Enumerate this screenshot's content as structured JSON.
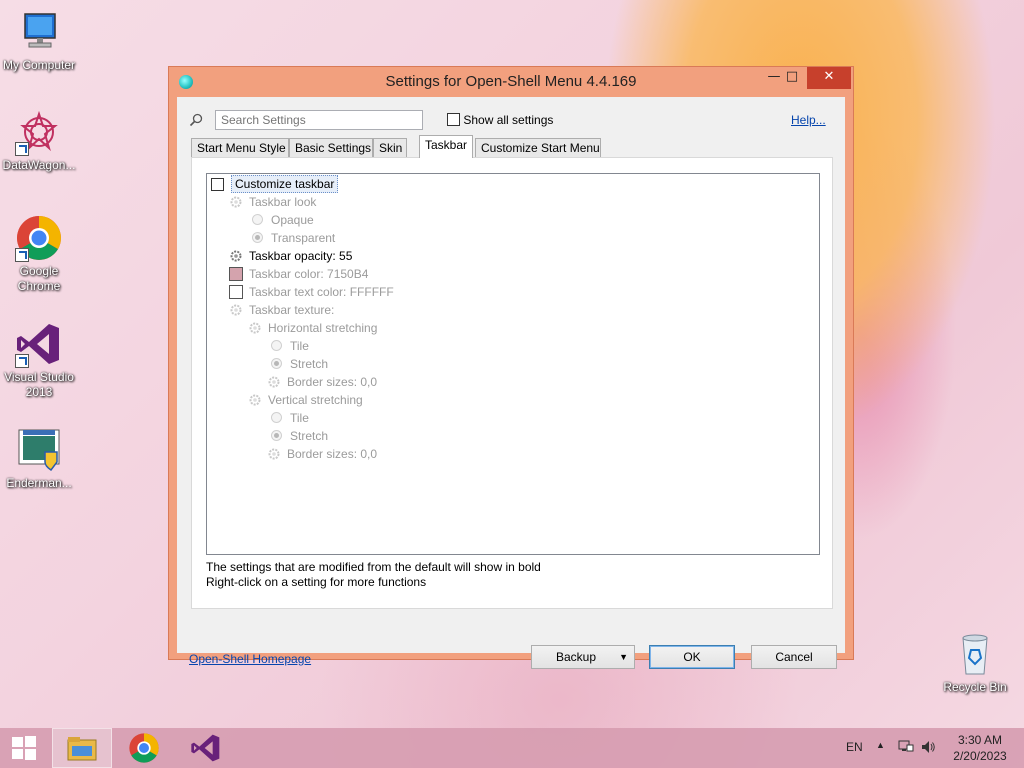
{
  "desktop": {
    "icons": [
      {
        "label": "My Computer",
        "icon": "computer-icon"
      },
      {
        "label": "DataWagon...",
        "icon": "datawagon-icon"
      },
      {
        "label": "Google Chrome",
        "icon": "chrome-icon"
      },
      {
        "label": "Visual Studio 2013",
        "icon": "visual-studio-icon"
      },
      {
        "label": "Enderman...",
        "icon": "enderman-app-icon"
      },
      {
        "label": "Recycle Bin",
        "icon": "recycle-bin-icon"
      }
    ]
  },
  "dialog": {
    "title": "Settings for Open-Shell Menu 4.4.169",
    "controls": {
      "minimize": "minimize-icon",
      "maximize": "maximize-icon",
      "close": "close-icon"
    },
    "search": {
      "placeholder": "Search Settings",
      "value": ""
    },
    "show_all_label": "Show all settings",
    "show_all_checked": false,
    "help_label": "Help...",
    "tabs": [
      {
        "label": "Start Menu Style",
        "active": false
      },
      {
        "label": "Basic Settings",
        "active": false
      },
      {
        "label": "Skin",
        "active": false
      },
      {
        "label": "Taskbar",
        "active": true
      },
      {
        "label": "Customize Start Menu",
        "active": false
      }
    ],
    "settings": {
      "customize_taskbar": "Customize taskbar",
      "taskbar_look": "Taskbar look",
      "opaque": "Opaque",
      "transparent": "Transparent",
      "taskbar_opacity": "Taskbar opacity: 55",
      "taskbar_color": "Taskbar color: 7150B4",
      "taskbar_color_swatch": "#d4a3ad",
      "taskbar_text_color": "Taskbar text color: FFFFFF",
      "taskbar_text_color_swatch": "#ffffff",
      "taskbar_texture": "Taskbar texture:",
      "horizontal_stretching": "Horizontal stretching",
      "h_tile": "Tile",
      "h_stretch": "Stretch",
      "h_border_sizes": "Border sizes: 0,0",
      "vertical_stretching": "Vertical stretching",
      "v_tile": "Tile",
      "v_stretch": "Stretch",
      "v_border_sizes": "Border sizes: 0,0"
    },
    "hint_line1": "The settings that are modified from the default will show in bold",
    "hint_line2": "Right-click on a setting for more functions",
    "homepage_label": "Open-Shell Homepage",
    "backup_label": "Backup",
    "ok_label": "OK",
    "cancel_label": "Cancel"
  },
  "taskbar": {
    "apps": [
      "start-icon",
      "file-explorer-icon",
      "chrome-icon",
      "visual-studio-icon"
    ],
    "language": "EN",
    "time": "3:30 AM",
    "date": "2/20/2023"
  },
  "colors": {
    "dialog_frame": "#f2a07e",
    "close_button": "#c7402c",
    "link": "#0645ad",
    "taskbar": "#d69cb0"
  }
}
